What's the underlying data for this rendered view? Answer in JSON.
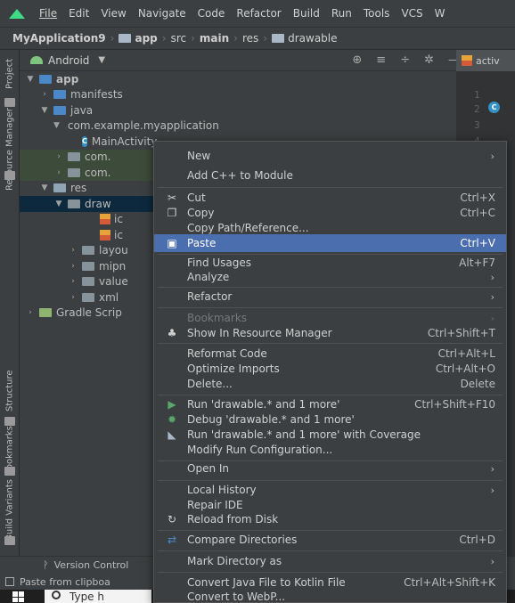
{
  "menubar": {
    "items": [
      "File",
      "Edit",
      "View",
      "Navigate",
      "Code",
      "Refactor",
      "Build",
      "Run",
      "Tools",
      "VCS",
      "W"
    ]
  },
  "breadcrumb": {
    "project": "MyApplication9",
    "module": "app",
    "src": "src",
    "main": "main",
    "res": "res",
    "drawable": "drawable"
  },
  "left_tabs": {
    "project": "Project",
    "resource_manager": "Resource Manager",
    "structure": "Structure",
    "bookmarks": "Bookmarks",
    "build_variants": "Build Variants"
  },
  "panel": {
    "view_selector": "Android"
  },
  "tree": {
    "app": "app",
    "manifests": "manifests",
    "java": "java",
    "package_main": "com.example.myapplication",
    "main_activity": "MainActivity",
    "pkg2": "com.",
    "pkg3": "com.",
    "res": "res",
    "drawable": "draw",
    "ic1": "ic",
    "ic2": "ic",
    "layout": "layou",
    "mipmap": "mipn",
    "values": "value",
    "xml": "xml",
    "gradle": "Gradle Scrip"
  },
  "editor": {
    "tab_label": "activ",
    "line_numbers": [
      "1",
      "2",
      "3",
      "4"
    ]
  },
  "context_menu": {
    "new": "New",
    "add_cpp": "Add C++ to Module",
    "cut": "Cut",
    "cut_sc": "Ctrl+X",
    "copy": "Copy",
    "copy_sc": "Ctrl+C",
    "copy_path": "Copy Path/Reference...",
    "paste": "Paste",
    "paste_sc": "Ctrl+V",
    "find_usages": "Find Usages",
    "find_usages_sc": "Alt+F7",
    "analyze": "Analyze",
    "refactor": "Refactor",
    "bookmarks": "Bookmarks",
    "show_in_rm": "Show In Resource Manager",
    "show_in_rm_sc": "Ctrl+Shift+T",
    "reformat": "Reformat Code",
    "reformat_sc": "Ctrl+Alt+L",
    "optimize": "Optimize Imports",
    "optimize_sc": "Ctrl+Alt+O",
    "delete": "Delete...",
    "delete_sc": "Delete",
    "run": "Run 'drawable.* and 1 more'",
    "run_sc": "Ctrl+Shift+F10",
    "debug": "Debug 'drawable.* and 1 more'",
    "run_cov": "Run 'drawable.* and 1 more' with Coverage",
    "modify_run": "Modify Run Configuration...",
    "open_in": "Open In",
    "local_history": "Local History",
    "repair_ide": "Repair IDE",
    "reload": "Reload from Disk",
    "compare": "Compare Directories",
    "compare_sc": "Ctrl+D",
    "mark_dir": "Mark Directory as",
    "convert_kotlin": "Convert Java File to Kotlin File",
    "convert_kotlin_sc": "Ctrl+Alt+Shift+K",
    "convert_webp": "Convert to WebP..."
  },
  "bottom": {
    "version_control": "Version Control",
    "status": "Paste from clipboa",
    "taskbar_search": "Type h"
  }
}
